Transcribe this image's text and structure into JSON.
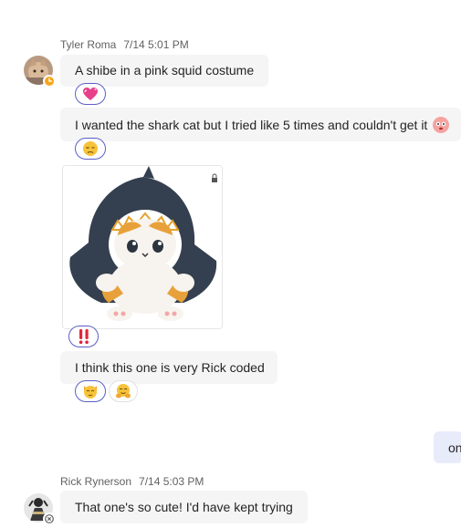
{
  "colors": {
    "bubble_other": "#f5f5f5",
    "bubble_me": "#e8ebfa",
    "reaction_mine_border": "#5b5fc7",
    "status_away": "#f8a51a"
  },
  "messages": [
    {
      "sender": "Tyler Roma",
      "time": "7/14 5:01 PM",
      "avatar_icon": "cat-photo-avatar",
      "presence": "away",
      "text": "A shibe in a pink squid costume",
      "reactions": [
        {
          "icon": "heart-emoji"
        }
      ]
    },
    {
      "text": "I wanted the shark cat but I tried like 5 times and couldn't get it",
      "trailing_emoji": "flushed-face-emoji",
      "reactions": [
        {
          "icon": "sad-face-emoji"
        }
      ]
    },
    {
      "image": "shark-cat-plush-image",
      "reactions": [
        {
          "icon": "double-exclamation-emoji",
          "text": "‼️"
        }
      ]
    },
    {
      "text": "I think this one is very Rick coded",
      "reactions": [
        {
          "icon": "cat-emoji",
          "text": "🐱"
        },
        {
          "icon": "hugging-face-emoji",
          "text": "🤗"
        }
      ]
    },
    {
      "sender": "me",
      "text": "on"
    },
    {
      "sender": "Rick Rynerson",
      "time": "7/14 5:03 PM",
      "avatar_icon": "photo-avatar",
      "presence": "offline",
      "text": "That one's so cute! I'd have kept trying"
    }
  ]
}
